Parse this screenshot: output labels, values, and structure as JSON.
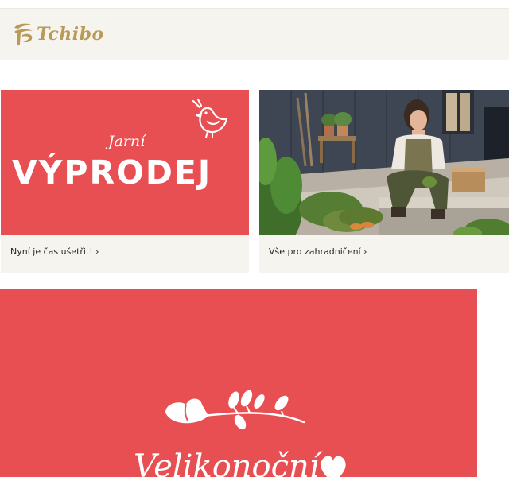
{
  "header": {
    "logo_text": "Tchibo"
  },
  "cards": [
    {
      "promo_small": "Jarní",
      "promo_big": "VÝPRODEJ",
      "link_label": "Nyní je čas ušetřit! ›"
    },
    {
      "link_label": "Vše pro zahradničení ›"
    }
  ],
  "banner": {
    "script_text": "Velikonoční"
  },
  "colors": {
    "promo_red": "#e84f52",
    "brand_gold": "#b99b57",
    "header_bg": "#f6f4ef"
  },
  "icons": [
    "tchibo-logo-icon",
    "bird-icon",
    "branch-icon",
    "heart-icon"
  ]
}
